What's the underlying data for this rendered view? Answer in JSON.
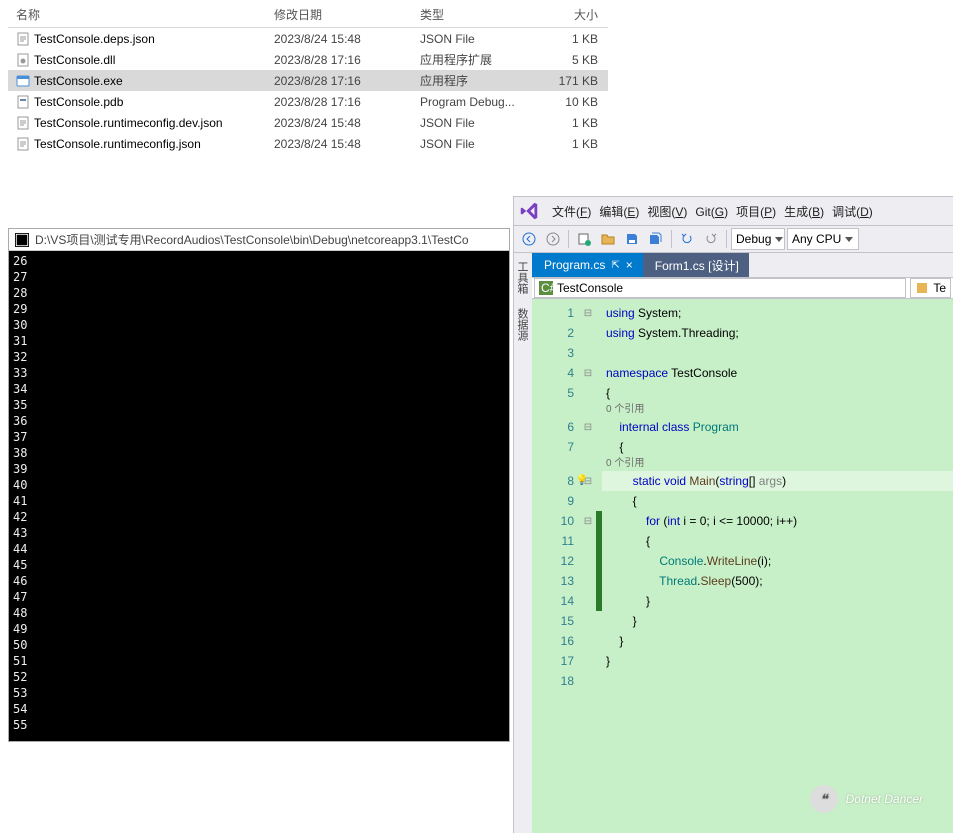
{
  "explorer": {
    "headers": {
      "name": "名称",
      "date": "修改日期",
      "type": "类型",
      "size": "大小"
    },
    "files": [
      {
        "name": "TestConsole.deps.json",
        "date": "2023/8/24 15:48",
        "type": "JSON File",
        "size": "1 KB",
        "icon": "json",
        "selected": false
      },
      {
        "name": "TestConsole.dll",
        "date": "2023/8/28 17:16",
        "type": "应用程序扩展",
        "size": "5 KB",
        "icon": "dll",
        "selected": false
      },
      {
        "name": "TestConsole.exe",
        "date": "2023/8/28 17:16",
        "type": "应用程序",
        "size": "171 KB",
        "icon": "exe",
        "selected": true
      },
      {
        "name": "TestConsole.pdb",
        "date": "2023/8/28 17:16",
        "type": "Program Debug...",
        "size": "10 KB",
        "icon": "pdb",
        "selected": false
      },
      {
        "name": "TestConsole.runtimeconfig.dev.json",
        "date": "2023/8/24 15:48",
        "type": "JSON File",
        "size": "1 KB",
        "icon": "json",
        "selected": false
      },
      {
        "name": "TestConsole.runtimeconfig.json",
        "date": "2023/8/24 15:48",
        "type": "JSON File",
        "size": "1 KB",
        "icon": "json",
        "selected": false
      }
    ]
  },
  "console": {
    "title": "D:\\VS项目\\测试专用\\RecordAudios\\TestConsole\\bin\\Debug\\netcoreapp3.1\\TestCo",
    "lines": [
      "26",
      "27",
      "28",
      "29",
      "30",
      "31",
      "32",
      "33",
      "34",
      "35",
      "36",
      "37",
      "38",
      "39",
      "40",
      "41",
      "42",
      "43",
      "44",
      "45",
      "46",
      "47",
      "48",
      "49",
      "50",
      "51",
      "52",
      "53",
      "54",
      "55"
    ]
  },
  "vs": {
    "menu": [
      "文件(F)",
      "编辑(E)",
      "视图(V)",
      "Git(G)",
      "项目(P)",
      "生成(B)",
      "调试(D)"
    ],
    "config": "Debug",
    "platform": "Any CPU",
    "tabs": [
      {
        "label": "Program.cs",
        "active": true
      },
      {
        "label": "Form1.cs [设计]",
        "active": false
      }
    ],
    "context_left": "TestConsole",
    "context_right": "Te",
    "codelens_refs": "0 个引用",
    "code": {
      "lines": [
        {
          "n": 1,
          "fold": "⊟",
          "html": "<span class='kw'>using</span> <span class='ns'>System</span>;"
        },
        {
          "n": 2,
          "fold": "",
          "html": "<span class='kw'>using</span> <span class='ns'>System.Threading</span>;"
        },
        {
          "n": 3,
          "fold": "",
          "html": ""
        },
        {
          "n": 4,
          "fold": "⊟",
          "html": "<span class='kw'>namespace</span> <span class='ns'>TestConsole</span>"
        },
        {
          "n": 5,
          "fold": "",
          "html": "{"
        },
        {
          "lens": true
        },
        {
          "n": 6,
          "fold": "⊟",
          "html": "    <span class='kw'>internal</span> <span class='kw'>class</span> <span class='cls'>Program</span>"
        },
        {
          "n": 7,
          "fold": "",
          "html": "    {"
        },
        {
          "lens": true
        },
        {
          "n": 8,
          "fold": "⊟",
          "bulb": true,
          "hl": true,
          "html": "        <span class='kw'>static</span> <span class='kw'>void</span> <span class='mtd'>Main</span>(<span class='kw'>string</span>[] <span class='param'>args</span>)"
        },
        {
          "n": 9,
          "fold": "",
          "html": "        {"
        },
        {
          "n": 10,
          "fold": "⊟",
          "changed": true,
          "html": "            <span class='kw'>for</span> (<span class='kw'>int</span> i = 0; i &lt;= 10000; i++)"
        },
        {
          "n": 11,
          "fold": "",
          "changed": true,
          "html": "            {"
        },
        {
          "n": 12,
          "fold": "",
          "changed": true,
          "html": "                <span class='cls'>Console</span>.<span class='mtd'>WriteLine</span>(i);"
        },
        {
          "n": 13,
          "fold": "",
          "changed": true,
          "html": "                <span class='cls'>Thread</span>.<span class='mtd'>Sleep</span>(500);"
        },
        {
          "n": 14,
          "fold": "",
          "changed": true,
          "html": "            }"
        },
        {
          "n": 15,
          "fold": "",
          "html": "        }"
        },
        {
          "n": 16,
          "fold": "",
          "html": "    }"
        },
        {
          "n": 17,
          "fold": "",
          "html": "}"
        },
        {
          "n": 18,
          "fold": "",
          "html": ""
        }
      ]
    },
    "sidebar_tabs": [
      "工具箱",
      "数据源"
    ]
  },
  "watermark": "Dotnet Dancer"
}
